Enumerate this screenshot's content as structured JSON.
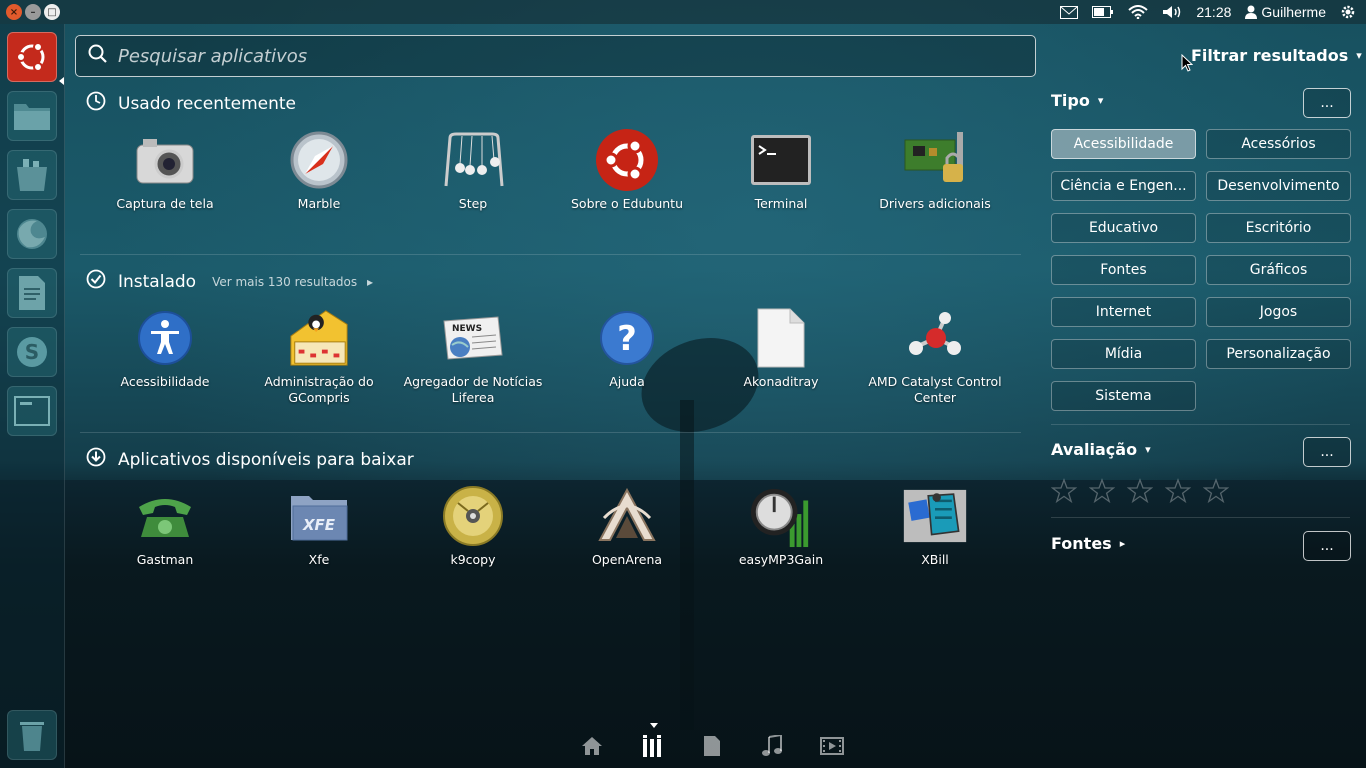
{
  "top_panel": {
    "time": "21:28",
    "user": "Guilherme",
    "window_buttons": [
      "close",
      "minimize",
      "maximize"
    ]
  },
  "launcher": {
    "items": [
      {
        "name": "ubuntu-dash-icon",
        "active": true
      },
      {
        "name": "files-icon"
      },
      {
        "name": "software-center-icon"
      },
      {
        "name": "firefox-icon"
      },
      {
        "name": "writer-icon"
      },
      {
        "name": "skype-icon"
      },
      {
        "name": "workspace-switcher-icon"
      },
      {
        "name": "trash-icon"
      }
    ]
  },
  "search": {
    "placeholder": "Pesquisar aplicativos",
    "value": ""
  },
  "sections": {
    "recent": {
      "title": "Usado recentemente",
      "apps": [
        {
          "label": "Captura de tela",
          "icon": "camera-icon"
        },
        {
          "label": "Marble",
          "icon": "globe-compass-icon"
        },
        {
          "label": "Step",
          "icon": "newtons-cradle-icon"
        },
        {
          "label": "Sobre o Edubuntu",
          "icon": "ubuntu-logo-icon"
        },
        {
          "label": "Terminal",
          "icon": "terminal-icon"
        },
        {
          "label": "Drivers adicionais",
          "icon": "hardware-driver-icon"
        }
      ]
    },
    "installed": {
      "title": "Instalado",
      "more": "Ver mais 130 resultados",
      "apps": [
        {
          "label": "Acessibilidade",
          "icon": "accessibility-icon"
        },
        {
          "label": "Administração do GCompris",
          "icon": "gcompris-admin-icon"
        },
        {
          "label": "Agregador de Notícias Liferea",
          "icon": "news-icon"
        },
        {
          "label": "Ajuda",
          "icon": "help-icon"
        },
        {
          "label": "Akonaditray",
          "icon": "document-icon"
        },
        {
          "label": "AMD Catalyst Control Center",
          "icon": "amd-catalyst-icon"
        }
      ]
    },
    "available": {
      "title": "Aplicativos disponíveis para baixar",
      "apps": [
        {
          "label": "Gastman",
          "icon": "phone-icon"
        },
        {
          "label": "Xfe",
          "icon": "folder-icon"
        },
        {
          "label": "k9copy",
          "icon": "dvd-icon"
        },
        {
          "label": "OpenArena",
          "icon": "openarena-icon"
        },
        {
          "label": "easyMP3Gain",
          "icon": "volume-knob-icon"
        },
        {
          "label": "XBill",
          "icon": "xbill-icon"
        }
      ]
    }
  },
  "filters": {
    "title": "Filtrar resultados",
    "tipo": {
      "label": "Tipo",
      "more": "...",
      "options": [
        {
          "label": "Acessibilidade",
          "selected": true
        },
        {
          "label": "Acessórios"
        },
        {
          "label": "Ciência e Engen..."
        },
        {
          "label": "Desenvolvimento"
        },
        {
          "label": "Educativo"
        },
        {
          "label": "Escritório"
        },
        {
          "label": "Fontes"
        },
        {
          "label": "Gráficos"
        },
        {
          "label": "Internet"
        },
        {
          "label": "Jogos"
        },
        {
          "label": "Mídia"
        },
        {
          "label": "Personalização"
        },
        {
          "label": "Sistema"
        }
      ]
    },
    "avaliacao": {
      "label": "Avaliação",
      "more": "...",
      "stars": 0,
      "max_stars": 5
    },
    "fontes": {
      "label": "Fontes",
      "more": "..."
    }
  },
  "lenses": [
    {
      "name": "home-lens-icon"
    },
    {
      "name": "applications-lens-icon",
      "active": true
    },
    {
      "name": "files-lens-icon"
    },
    {
      "name": "music-lens-icon"
    },
    {
      "name": "video-lens-icon"
    }
  ]
}
